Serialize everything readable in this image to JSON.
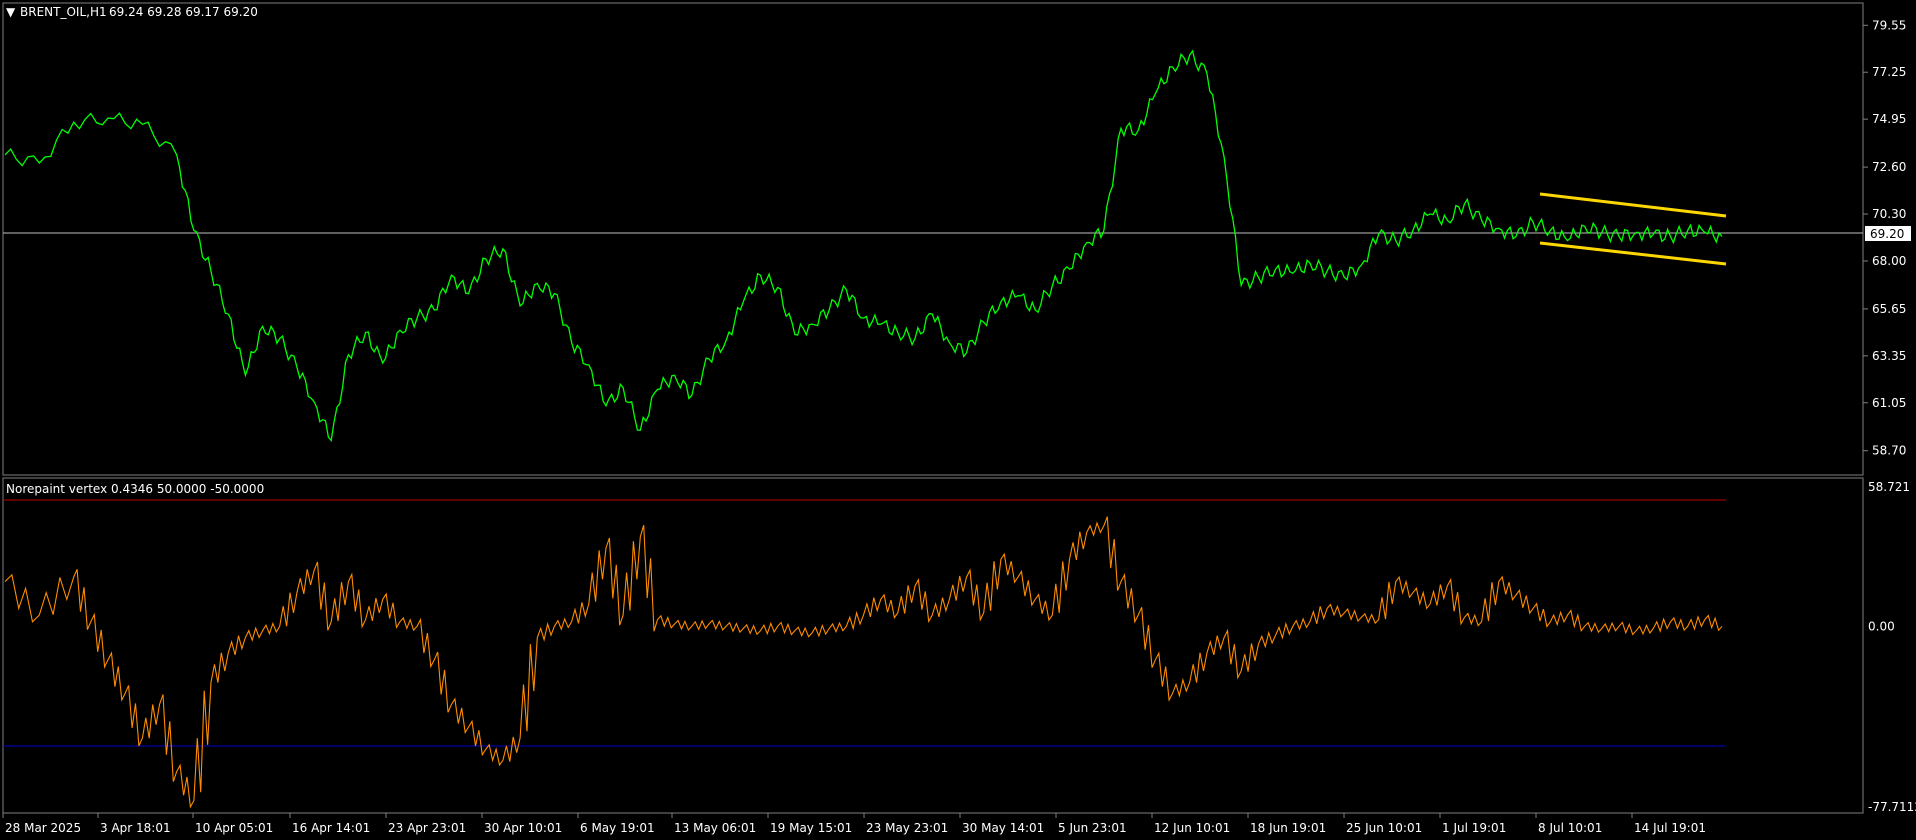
{
  "main_panel": {
    "symbol_timeframe": "BRENT_OIL,H1",
    "ohlc": "69.24 69.28 69.17 69.20",
    "current_price_label": "69.20",
    "price_line_color": "#c0c0c0",
    "price_series_color": "#00ff00",
    "channel_color": "#ffd700",
    "y_ticks": [
      "79.55",
      "77.25",
      "74.95",
      "72.60",
      "70.30",
      "68.00",
      "65.65",
      "63.35",
      "61.05",
      "58.70"
    ]
  },
  "sub_panel": {
    "indicator_header": "Norepaint vertex 0.4346 50.0000 -50.0000",
    "y_ticks": [
      "58.721",
      "0.00",
      "-77.7112"
    ],
    "upper_level_color": "#c00000",
    "lower_level_color": "#0000d0",
    "series_color": "#ff8c00"
  },
  "x_labels": [
    "28 Mar 2025",
    "3 Apr 18:01",
    "10 Apr 05:01",
    "16 Apr 14:01",
    "23 Apr 23:01",
    "30 Apr 10:01",
    "6 May 19:01",
    "13 May 06:01",
    "19 May 15:01",
    "23 May 23:01",
    "30 May 14:01",
    "5 Jun 23:01",
    "12 Jun 10:01",
    "18 Jun 19:01",
    "25 Jun 10:01",
    "1 Jul 19:01",
    "8 Jul 10:01",
    "14 Jul 19:01"
  ],
  "chart_data": [
    {
      "type": "line",
      "ylim": [
        58.0,
        80.3
      ],
      "x_index": [
        0,
        2,
        4,
        6,
        8,
        10,
        11,
        12,
        13,
        14,
        15,
        16,
        17,
        18,
        19,
        20,
        21,
        22,
        23,
        24,
        25,
        26,
        27,
        28,
        29,
        30,
        31,
        32,
        33,
        34,
        35,
        36,
        37,
        38,
        39,
        40,
        41,
        42,
        43,
        44,
        45,
        46,
        47,
        48,
        49,
        50,
        51,
        52,
        53,
        54,
        55,
        56,
        57,
        58,
        59,
        60,
        61,
        62,
        63,
        64,
        65,
        66,
        67,
        68,
        69,
        70,
        71,
        72,
        73,
        74,
        75,
        76,
        77,
        78,
        79,
        80,
        81,
        82,
        83,
        84,
        85,
        86,
        87,
        88,
        89,
        90,
        91,
        92,
        93,
        94,
        95,
        96,
        97,
        98,
        99,
        100
      ],
      "values": [
        73.2,
        72.8,
        74.8,
        75.0,
        74.7,
        73.2,
        69.5,
        67.5,
        65.4,
        62.4,
        64.8,
        64.2,
        62.8,
        61.1,
        59.2,
        63.4,
        64.5,
        63.0,
        64.6,
        65.2,
        65.6,
        67.3,
        66.4,
        68.1,
        68.6,
        65.8,
        66.9,
        66.4,
        64.0,
        62.9,
        60.9,
        61.8,
        59.7,
        61.7,
        62.4,
        61.4,
        63.2,
        64.1,
        66.0,
        67.3,
        66.7,
        64.4,
        64.9,
        65.6,
        66.6,
        65.2,
        64.9,
        64.5,
        64.2,
        65.4,
        64.0,
        63.5,
        65.0,
        66.0,
        66.3,
        65.6,
        66.8,
        67.6,
        68.9,
        69.5,
        74.5,
        74.4,
        76.2,
        77.5,
        78.1,
        77.2,
        73.1,
        66.8,
        67.2,
        67.6,
        67.4,
        67.9,
        67.5,
        67.2,
        67.8,
        69.3,
        69.0,
        69.5,
        70.3,
        70.0,
        70.8,
        70.0,
        69.6,
        69.2,
        69.9,
        69.5,
        69.0,
        69.7,
        69.4,
        69.2,
        69.4,
        69.3,
        69.2,
        69.5,
        69.4,
        69.2
      ]
    },
    {
      "type": "line",
      "ylim": [
        -77.7112,
        58.721
      ],
      "x_index": [
        0,
        2,
        4,
        5,
        6,
        7,
        8,
        9,
        10,
        11,
        12,
        13,
        14,
        15,
        16,
        17,
        18,
        19,
        20,
        21,
        22,
        23,
        24,
        25,
        26,
        27,
        28,
        29,
        30,
        31,
        32,
        33,
        34,
        35,
        36,
        37,
        38,
        39,
        40,
        41,
        42,
        43,
        44,
        45,
        46,
        47,
        48,
        49,
        50,
        51,
        52,
        53,
        54,
        55,
        56,
        57,
        58,
        59,
        60,
        61,
        62,
        63,
        64,
        65,
        66,
        67,
        68,
        69,
        70,
        71,
        72,
        73,
        74,
        75,
        76,
        77,
        78,
        79,
        80,
        81,
        82,
        83,
        84,
        85,
        86,
        87,
        88,
        89,
        90,
        91,
        92,
        93,
        94,
        95,
        96,
        97,
        98,
        99,
        100
      ],
      "values": [
        20,
        5,
        22,
        2,
        -15,
        -30,
        -50,
        -35,
        -65,
        -78,
        -25,
        -12,
        -5,
        -2,
        0,
        15,
        25,
        2,
        20,
        3,
        12,
        2,
        0,
        -15,
        -35,
        -45,
        -55,
        -60,
        -50,
        -5,
        0,
        2,
        10,
        35,
        5,
        40,
        3,
        1,
        0,
        1,
        0,
        -1,
        -2,
        0,
        -2,
        -3,
        -1,
        0,
        5,
        12,
        6,
        18,
        5,
        12,
        22,
        6,
        30,
        22,
        12,
        5,
        30,
        42,
        45,
        20,
        5,
        -15,
        -30,
        -25,
        -12,
        -5,
        -20,
        -8,
        -4,
        0,
        2,
        8,
        6,
        4,
        3,
        20,
        15,
        10,
        18,
        4,
        2,
        20,
        14,
        8,
        2,
        5,
        0,
        -1,
        0,
        -2,
        -1,
        2,
        0,
        3,
        0
      ]
    }
  ]
}
